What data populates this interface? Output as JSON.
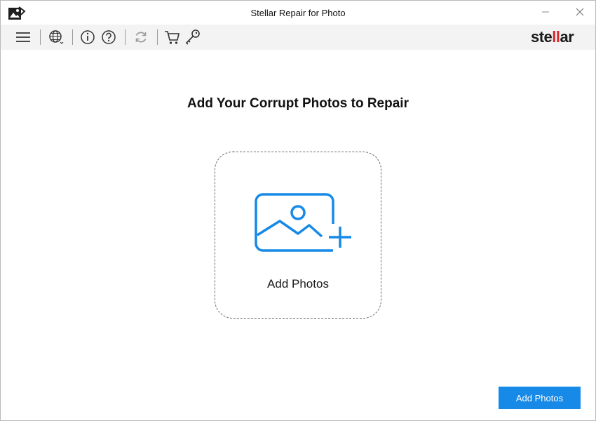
{
  "window": {
    "title": "Stellar Repair for Photo"
  },
  "toolbar": {
    "icons": [
      "menu-icon",
      "globe-icon",
      "info-icon",
      "help-icon",
      "refresh-icon",
      "cart-icon",
      "key-icon"
    ],
    "brand": {
      "prefix": "ste",
      "highlight": "ll",
      "suffix": "ar"
    }
  },
  "main": {
    "heading": "Add Your Corrupt Photos to Repair",
    "dropzone_label": "Add Photos",
    "add_button_label": "Add Photos"
  },
  "colors": {
    "accent": "#1789e6",
    "brand_highlight": "#d6262b",
    "toolbar_bg": "#f3f3f3"
  }
}
